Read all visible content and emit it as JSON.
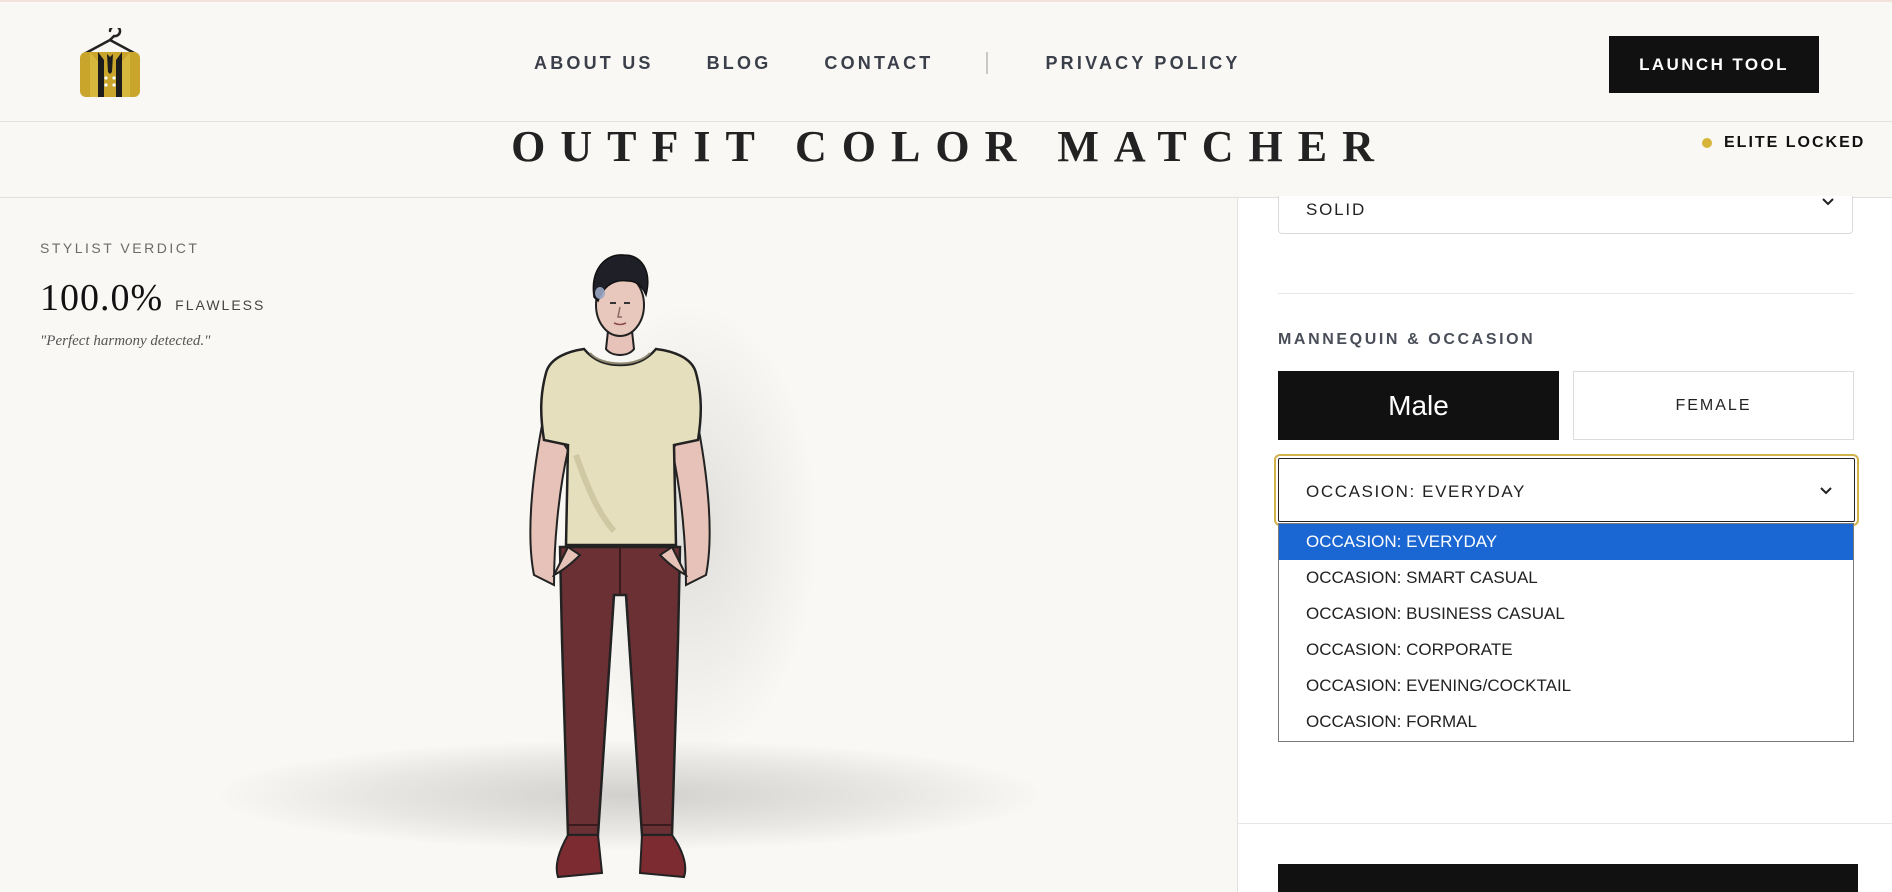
{
  "header": {
    "logo_icon": "hanger-suit-logo-icon",
    "nav": [
      {
        "label": "ABOUT US"
      },
      {
        "label": "BLOG"
      },
      {
        "label": "CONTACT"
      },
      {
        "label": "PRIVACY POLICY"
      }
    ],
    "launch_label": "LAUNCH TOOL"
  },
  "titlebar": {
    "title": "OUTFIT COLOR MATCHER",
    "elite_label": "ELITE LOCKED",
    "elite_dot_color": "#d7b53a"
  },
  "verdict": {
    "label": "STYLIST VERDICT",
    "score": "100.0%",
    "rating": "FLAWLESS",
    "quote": "\"Perfect harmony detected.\""
  },
  "mannequin": {
    "shirt_color": "#e6dfbd",
    "pants_color": "#6b3034",
    "shoes_color": "#7c2b30",
    "skin_color": "#e6c2b8"
  },
  "panel": {
    "pattern_value": "SOLID",
    "section_label": "MANNEQUIN & OCCASION",
    "male_label": "Male",
    "female_label": "FEMALE",
    "occasion_value": "OCCASION: EVERYDAY",
    "occasion_options": [
      {
        "label": "OCCASION: EVERYDAY",
        "selected": true
      },
      {
        "label": "OCCASION: SMART CASUAL",
        "selected": false
      },
      {
        "label": "OCCASION: BUSINESS CASUAL",
        "selected": false
      },
      {
        "label": "OCCASION: CORPORATE",
        "selected": false
      },
      {
        "label": "OCCASION: EVENING/COCKTAIL",
        "selected": false
      },
      {
        "label": "OCCASION: FORMAL",
        "selected": false
      }
    ]
  },
  "colors": {
    "accent_gold": "#d2b24a",
    "selection_blue": "#1a66d2"
  }
}
